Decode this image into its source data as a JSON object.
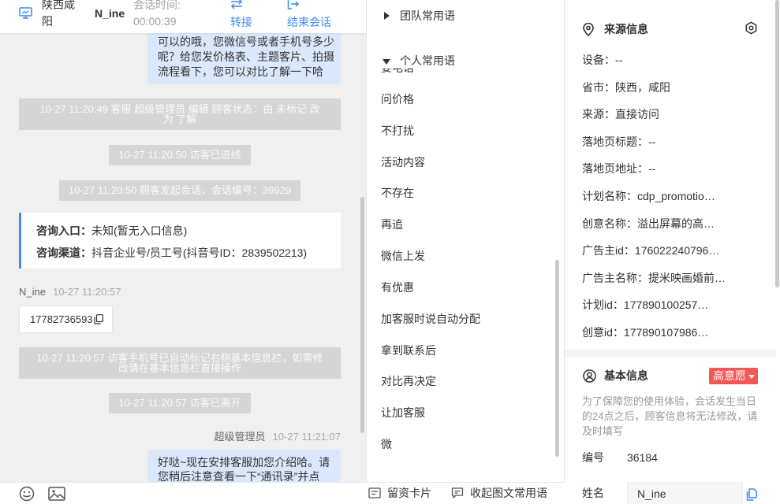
{
  "colors": {
    "accent": "#3d8af0",
    "agent_bubble": "#dbe8fc",
    "system_message_bg": "#d5d5d5",
    "chat_background": "#f0f0f0",
    "card_border": "#4a8af4",
    "intent_badge": "#f25656"
  },
  "icons": [
    "monitor-icon",
    "transfer-icon",
    "exit-icon",
    "copy-icon",
    "emoji-icon",
    "image-icon",
    "card-icon",
    "collapse-icon",
    "caret-right-icon",
    "caret-down-icon",
    "location-pin-icon",
    "settings-icon",
    "user-circle-icon"
  ],
  "header": {
    "location": "陕西咸阳",
    "visitor_name": "N_ine",
    "session_time_label": "会话时间:",
    "session_time": "00:00:39",
    "transfer_label": "转接",
    "end_session_label": "结束会话"
  },
  "chat": {
    "agent_message_1": "可以的哦，您微信号或者手机号多少呢？给您发价格表、主题客片、拍摄流程看下，您可以对比了解一下哈",
    "system_status_change": "10-27 11:20:49 客服 超级管理员 编辑 顾客状态：由 未标记 改为 了解",
    "system_visitor_joined": "10-27 11:20:50 访客已进线",
    "system_session_started": "10-27 11:20:50 顾客发起会话，会话编号：39929",
    "source_card": {
      "entry_label": "咨询入口：",
      "entry_value": "未知(暂无入口信息)",
      "channel_label": "咨询渠道：",
      "channel_value": "抖音企业号/员工号(抖音号ID：2839502213)"
    },
    "visitor_message": {
      "name": "N_ine",
      "time": "10-27 11:20:57",
      "text": "17782736593"
    },
    "system_phone_marked": "10-27 11:20:57 访客手机号已自动标记右侧基本信息栏，如需修改请在基本信息栏直接操作",
    "system_visitor_left": "10-27 11:20:57 访客已离开",
    "agent_message_2": {
      "name": "超级管理员",
      "time": "10-27 11:21:07",
      "text": "好哒~现在安排客服加您介绍哈。请您稍后注意查看一下“通讯录”并点"
    }
  },
  "toolbar": {
    "card_label": "留资卡片",
    "collapse_label": "收起图文常用语"
  },
  "quick_phrases": {
    "team_label": "团队常用语",
    "personal_label": "个人常用语",
    "items": [
      "要电话",
      "问价格",
      "不打扰",
      "活动内容",
      "不存在",
      "再追",
      "微信上发",
      "有优惠",
      "加客服时说自动分配",
      "拿到联系后",
      "对比再决定",
      "让加客服",
      "微"
    ]
  },
  "source_info": {
    "title": "来源信息",
    "fields": [
      {
        "label": "设备：",
        "value": "--"
      },
      {
        "label": "省市：",
        "value": "陕西，咸阳"
      },
      {
        "label": "来源：",
        "value": "直接访问"
      },
      {
        "label": "落地页标题：",
        "value": "--"
      },
      {
        "label": "落地页地址：",
        "value": "--"
      },
      {
        "label": "计划名称：",
        "value": "cdp_promotio…"
      },
      {
        "label": "创意名称：",
        "value": "溢出屏幕的高…"
      },
      {
        "label": "广告主id：",
        "value": "176022240796…"
      },
      {
        "label": "广告主名称：",
        "value": "提米映画婚前…"
      },
      {
        "label": "计划id：",
        "value": "177890100257…"
      },
      {
        "label": "创意id：",
        "value": "177890107986…"
      }
    ]
  },
  "basic_info": {
    "title": "基本信息",
    "intent_badge": "高意愿",
    "notice": "为了保障您的使用体验，会话发生当日的24点之后，顾客信息将无法修改，请及时填写",
    "id_label": "编号",
    "id_value": "36184",
    "name_label": "姓名",
    "name_value": "N_ine"
  }
}
